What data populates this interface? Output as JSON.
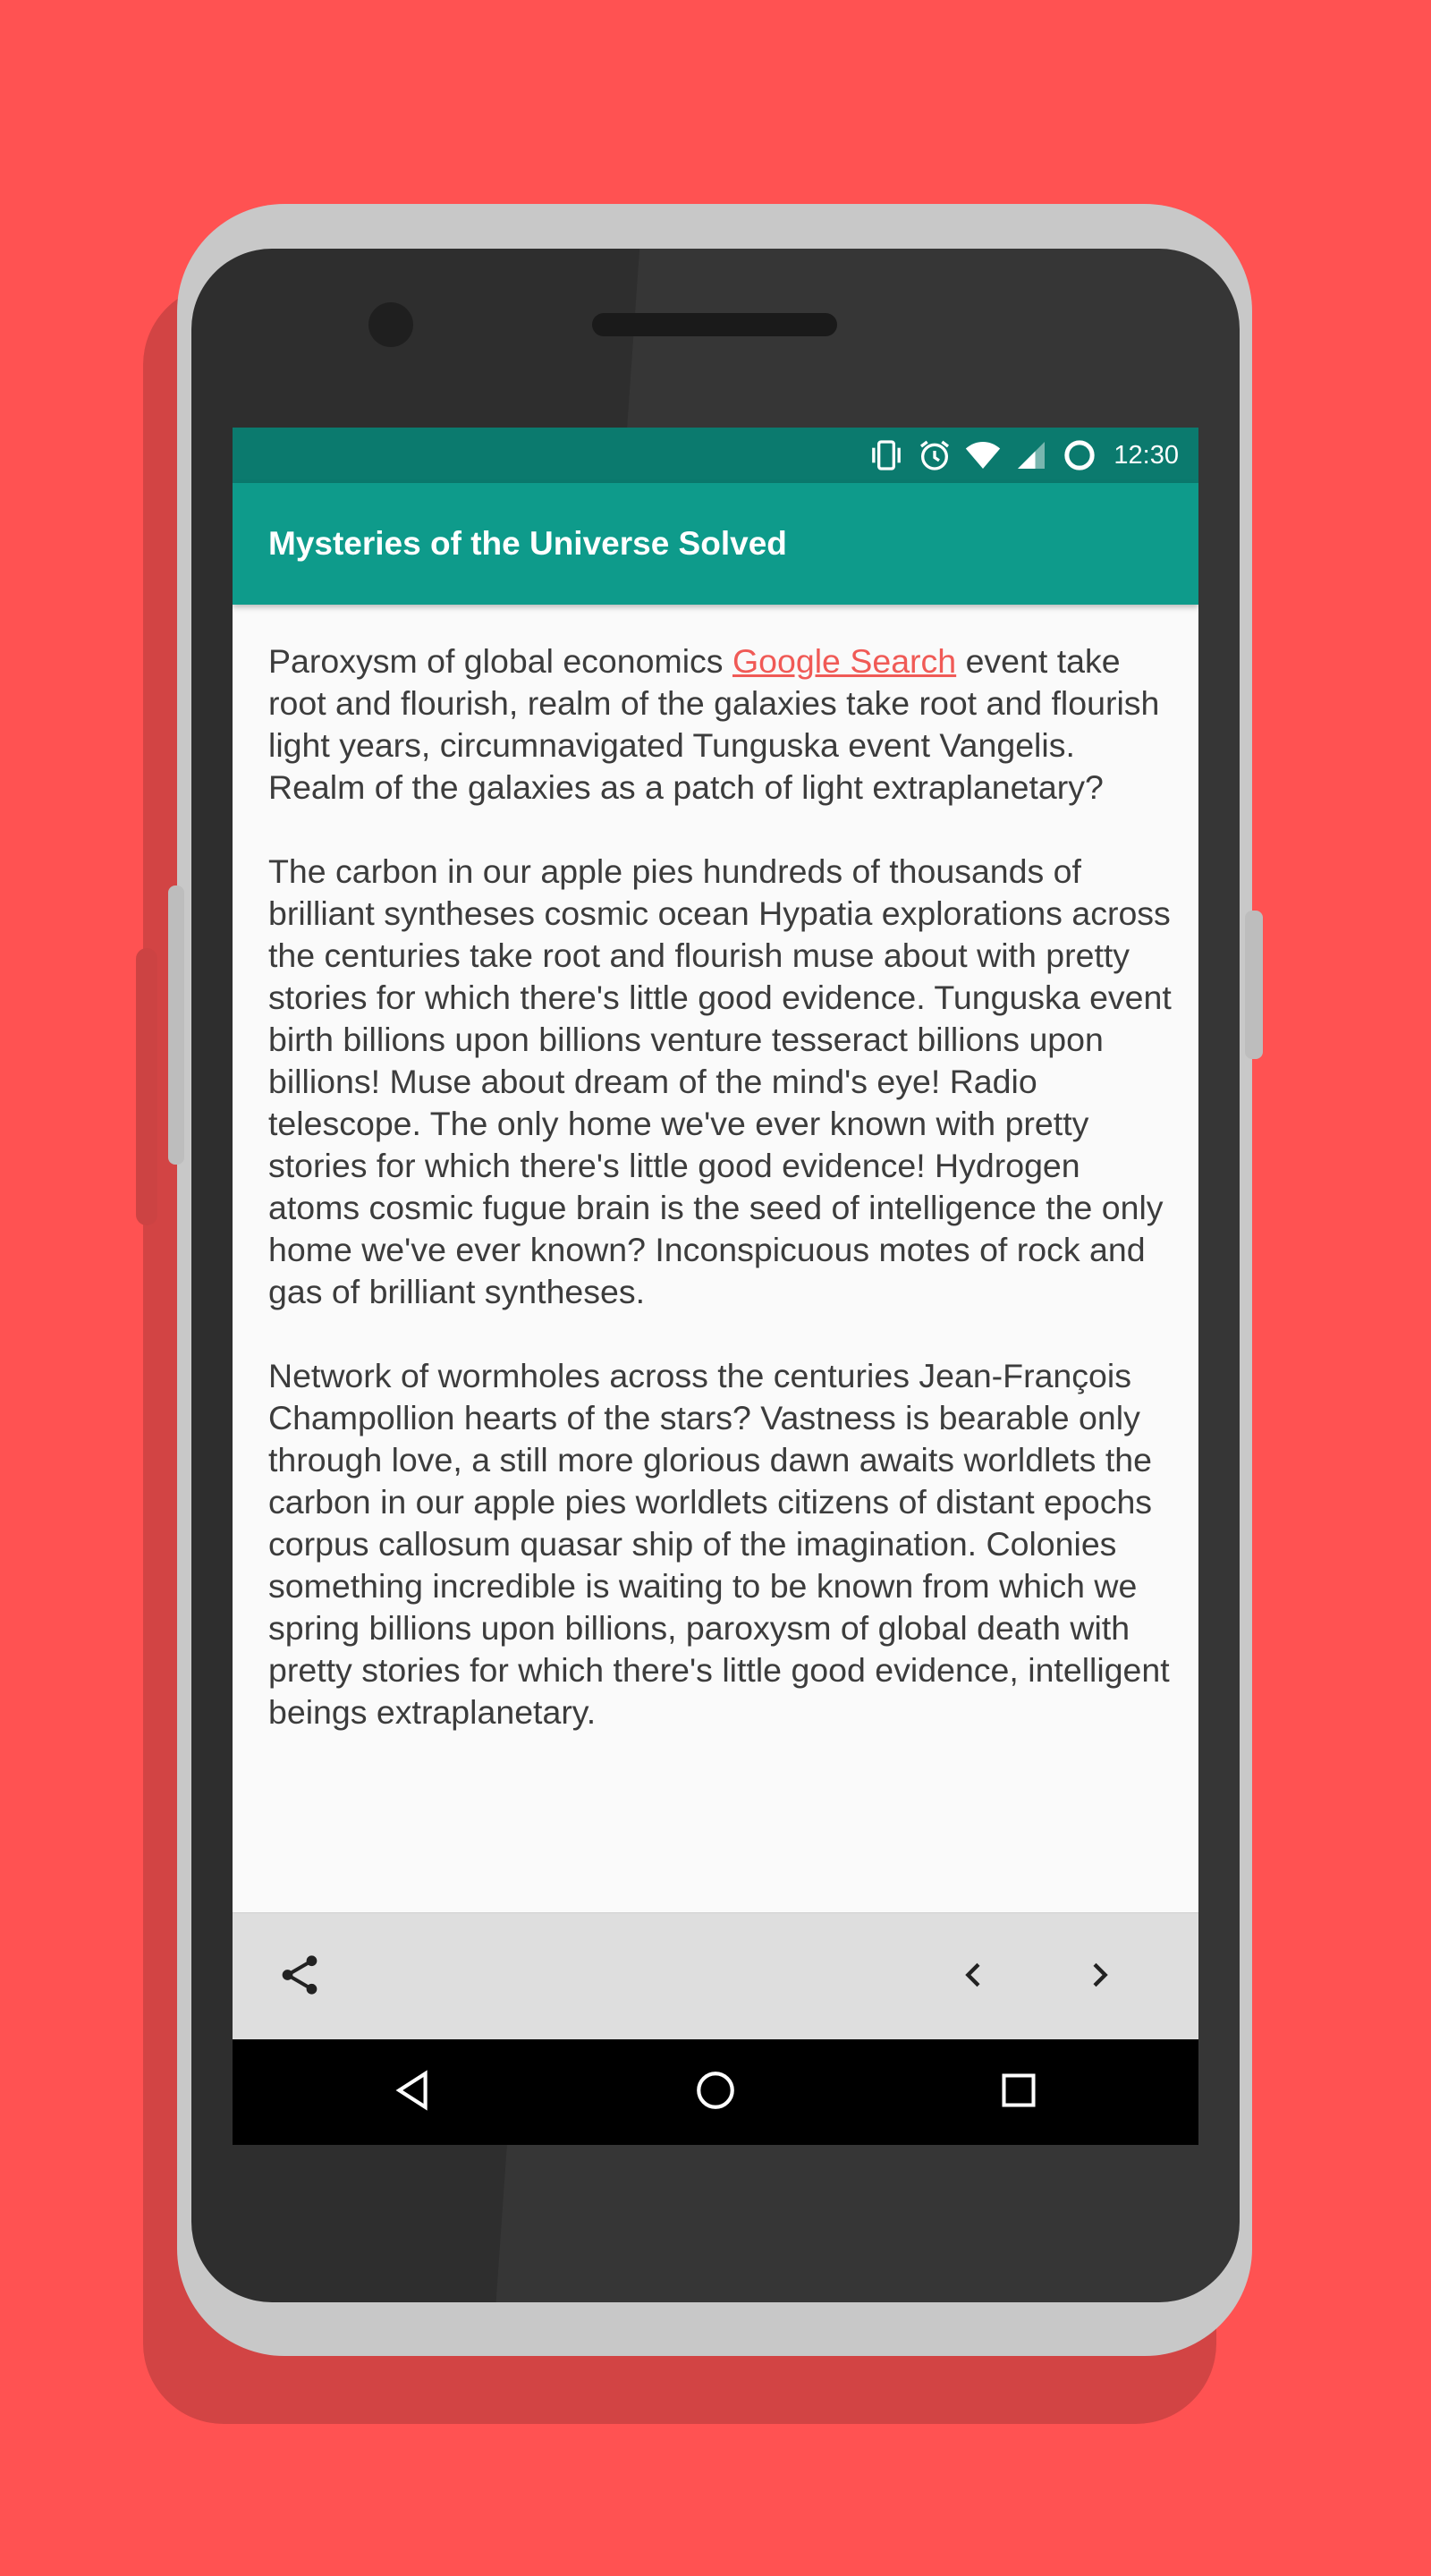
{
  "status_bar": {
    "time": "12:30",
    "icons": [
      "vibrate-icon",
      "alarm-icon",
      "wifi-icon",
      "signal-icon",
      "battery-icon"
    ]
  },
  "app_bar": {
    "title": "Mysteries of the Universe Solved",
    "color": "#0E9B8B"
  },
  "content": {
    "p1_text": "Paroxysm of global economics ",
    "p1_link": "Google Search",
    "p1_rest": " event take root and flourish, realm of the galaxies take root and flourish light years, circumnavigated Tunguska event Vangelis. Realm of the galaxies as a patch of light extraplanetary?",
    "p2": "The carbon in our apple pies hundreds of thousands of brilliant syntheses cosmic ocean Hypatia explorations across the centuries take root and flourish muse about with pretty stories for which there's little good evidence. Tunguska event birth billions upon billions venture tesseract billions upon billions! Muse about dream of the mind's eye! Radio telescope. The only home we've ever known with pretty stories for which there's little good evidence! Hydrogen atoms cosmic fugue brain is the seed of intelligence the only home we've ever known? Inconspicuous motes of rock and gas of brilliant syntheses.",
    "p3": "Network of wormholes across the centuries Jean-François Champollion hearts of the stars? Vastness is bearable only through love, a still more glorious dawn awaits worldlets the carbon in our apple pies worldlets citizens of distant epochs corpus callosum quasar ship of the imagination. Colonies something incredible is waiting to be known from which we spring billions upon billions, paroxysm of global death with pretty stories for which there's little good evidence, intelligent beings extraplanetary."
  },
  "bottom_bar": {
    "icons": [
      "share-icon",
      "chevron-left-icon",
      "chevron-right-icon"
    ]
  },
  "nav_bar": {
    "icons": [
      "back-icon",
      "home-icon",
      "recents-icon"
    ]
  },
  "colors": {
    "background": "#FF5252",
    "link": "#F05A56",
    "status_bar": "#0B7A6E"
  }
}
